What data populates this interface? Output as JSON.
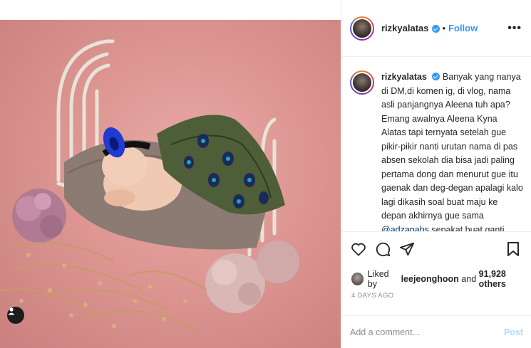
{
  "post": {
    "username": "rizkyalatas",
    "separator": "•",
    "follow_label": "Follow",
    "more_label": "•••"
  },
  "caption": {
    "username": "rizkyalatas",
    "text_part1": "Banyak yang nanya di DM,di komen ig, di vlog, nama asli panjangnya Aleena tuh apa? Emang awalnya Aleena Kyna Alatas tapi ternyata setelah gue pikir-pikir nanti urutan nama di pas absen sekolah dia bisa jadi paling pertama dong dan menurut gue itu gaenak dan deg-degan apalagi kalo lagi dikasih soal buat maju ke depan akhirnya gue sama",
    "mention": "@adzanabs",
    "text_part2": "sepakat buat ganti"
  },
  "likes": {
    "prefix": "Liked by",
    "user": "leejeonghoon",
    "and": "and",
    "count": "91,928 others"
  },
  "timestamp": "4 DAYS AGO",
  "comment": {
    "placeholder": "Add a comment...",
    "post_label": "Post"
  },
  "colors": {
    "accent": "#3897f0",
    "post_disabled": "#b3dbff",
    "mention": "#003569"
  },
  "icons": [
    "heart-icon",
    "comment-icon",
    "share-icon",
    "bookmark-icon",
    "user-tag-icon",
    "verified-icon"
  ]
}
